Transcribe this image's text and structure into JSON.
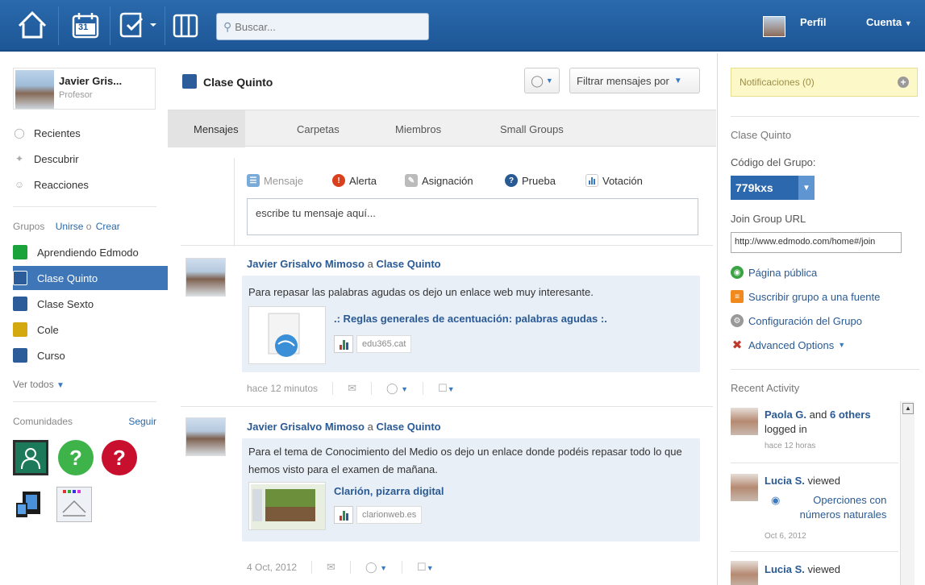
{
  "topbar": {
    "search_placeholder": "Buscar...",
    "calendar_day": "31",
    "profile_label": "Perfil",
    "account_label": "Cuenta"
  },
  "sidebar": {
    "user_name": "Javier Gris...",
    "user_role": "Profesor",
    "nav": [
      {
        "label": "Recientes",
        "icon": "chat-bubble-icon"
      },
      {
        "label": "Descubrir",
        "icon": "compass-icon"
      },
      {
        "label": "Reacciones",
        "icon": "smiley-icon"
      }
    ],
    "groups_label": "Grupos",
    "join_label": "Unirse",
    "or_label": "o",
    "create_label": "Crear",
    "groups": [
      {
        "label": "Aprendiendo Edmodo",
        "color": "#1aa33a"
      },
      {
        "label": "Clase Quinto",
        "color": "#2c5d9a",
        "active": true
      },
      {
        "label": "Clase Sexto",
        "color": "#2c5d9a"
      },
      {
        "label": "Cole",
        "color": "#d4a90f"
      },
      {
        "label": "Curso",
        "color": "#2c5d9a"
      }
    ],
    "see_all_label": "Ver todos",
    "communities_label": "Comunidades",
    "follow_label": "Seguir"
  },
  "main": {
    "group_title": "Clase Quinto",
    "filter_label": "Filtrar mensajes por",
    "tabs": [
      "Mensajes",
      "Carpetas",
      "Miembros",
      "Small Groups"
    ],
    "composer": {
      "types": [
        "Mensaje",
        "Alerta",
        "Asignación",
        "Prueba",
        "Votación"
      ],
      "placeholder": "escribe tu mensaje aquí..."
    },
    "posts": [
      {
        "author": "Javier Grisalvo Mimoso",
        "connector": "a",
        "group": "Clase Quinto",
        "text": "Para repasar las palabras agudas os dejo un enlace web muy interesante.",
        "link_title": ".: Reglas generales de acentuación: palabras agudas :.",
        "domain": "edu365.cat",
        "time": "hace 12 minutos"
      },
      {
        "author": "Javier Grisalvo Mimoso",
        "connector": "a",
        "group": "Clase Quinto",
        "text": "Para el tema de Conocimiento del Medio os dejo un enlace donde podéis repasar todo lo que hemos visto para el examen de mañana.",
        "link_title": "Clarión, pizarra digital",
        "domain": "clarionweb.es",
        "time": "4 Oct, 2012"
      }
    ]
  },
  "right": {
    "notifications_label": "Notificaciones (0)",
    "group_heading": "Clase Quinto",
    "group_code_label": "Código del Grupo:",
    "group_code": "779kxs",
    "join_url_label": "Join Group URL",
    "join_url": "http://www.edmodo.com/home#/join",
    "links": [
      {
        "label": "Página pública",
        "icon": "globe-icon",
        "color": "#3aa344"
      },
      {
        "label": "Suscribir grupo a una fuente",
        "icon": "rss-icon",
        "color": "#f08a1e"
      },
      {
        "label": "Configuración del Grupo",
        "icon": "gear-icon",
        "color": "#999999"
      },
      {
        "label": "Advanced Options",
        "icon": "tools-icon",
        "color": "#c0392b"
      }
    ],
    "recent_activity_label": "Recent Activity",
    "activity": [
      {
        "user": "Paola G.",
        "rest": "and",
        "others": "6 others",
        "tail": "logged in",
        "time": "hace 12 horas"
      },
      {
        "user": "Lucia S.",
        "rest": "viewed",
        "item": "Operciones con números naturales",
        "time": "Oct 6, 2012"
      },
      {
        "user": "Lucia S.",
        "rest": "viewed"
      }
    ]
  }
}
